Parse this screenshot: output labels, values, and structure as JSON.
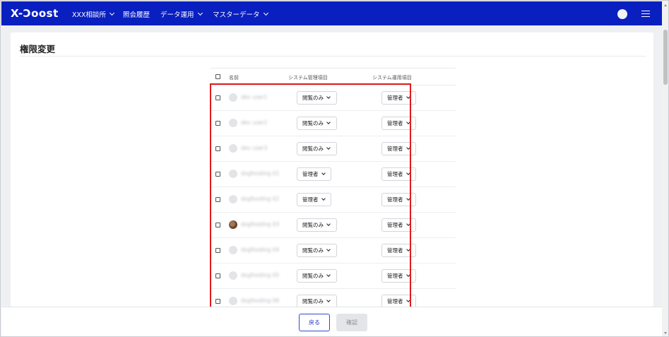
{
  "header": {
    "logo": "X-Ɔoost",
    "nav": [
      {
        "label": "XXX相談所",
        "has_dropdown": true
      },
      {
        "label": "照会履歴",
        "has_dropdown": false
      },
      {
        "label": "データ運用",
        "has_dropdown": true
      },
      {
        "label": "マスターデータ",
        "has_dropdown": true
      }
    ],
    "avatar_icon": "user-avatar",
    "menu_icon": "hamburger-menu-icon"
  },
  "page": {
    "title": "権限変更"
  },
  "table": {
    "columns": [
      "",
      "名前",
      "システム管理項目",
      "システム運用項目"
    ],
    "rows": [
      {
        "name": "dev user1",
        "avatar": "placeholder",
        "system_admin": "閲覧のみ",
        "system_ops": "管理者"
      },
      {
        "name": "dev user2",
        "avatar": "placeholder",
        "system_admin": "閲覧のみ",
        "system_ops": "管理者"
      },
      {
        "name": "dev user3",
        "avatar": "placeholder",
        "system_admin": "閲覧のみ",
        "system_ops": "管理者"
      },
      {
        "name": "dogfooding 01",
        "avatar": "placeholder",
        "system_admin": "管理者",
        "system_ops": "管理者"
      },
      {
        "name": "dogfooding 02",
        "avatar": "placeholder",
        "system_admin": "管理者",
        "system_ops": "管理者"
      },
      {
        "name": "dogfooding 03",
        "avatar": "photo",
        "system_admin": "閲覧のみ",
        "system_ops": "管理者"
      },
      {
        "name": "dogfooding 04",
        "avatar": "placeholder",
        "system_admin": "閲覧のみ",
        "system_ops": "管理者"
      },
      {
        "name": "dogfooding 05",
        "avatar": "placeholder",
        "system_admin": "閲覧のみ",
        "system_ops": "管理者"
      },
      {
        "name": "dogfooding 06",
        "avatar": "placeholder",
        "system_admin": "閲覧のみ",
        "system_ops": "管理者"
      }
    ]
  },
  "footer": {
    "back_label": "戻る",
    "confirm_label": "確認"
  },
  "colors": {
    "header_bg": "#0a1fbf",
    "highlight": "#e01b1b",
    "primary": "#1d33c4"
  }
}
